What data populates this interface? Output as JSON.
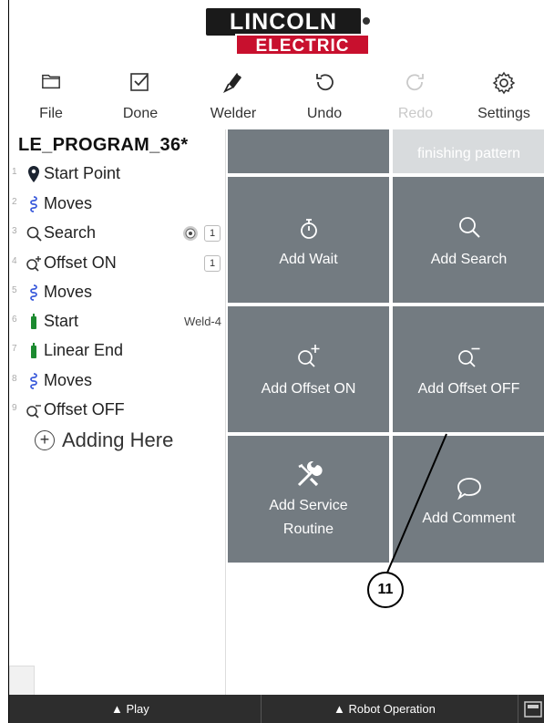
{
  "logo": {
    "line1": "LINCOLN",
    "line2": "ELECTRIC"
  },
  "toolbar": {
    "file": "File",
    "done": "Done",
    "welder": "Welder",
    "undo": "Undo",
    "redo": "Redo",
    "settings": "Settings"
  },
  "program": {
    "title": "LE_PROGRAM_36*",
    "items": [
      {
        "num": "1",
        "label": "Start Point",
        "icon": "location-pin-icon"
      },
      {
        "num": "2",
        "label": "Moves",
        "icon": "moves-squiggle-icon"
      },
      {
        "num": "3",
        "label": "Search",
        "icon": "search-icon",
        "badge": "1"
      },
      {
        "num": "4",
        "label": "Offset ON",
        "icon": "offset-on-icon",
        "badge": "1"
      },
      {
        "num": "5",
        "label": "Moves",
        "icon": "moves-squiggle-icon"
      },
      {
        "num": "6",
        "label": "Start",
        "icon": "weld-torch-icon",
        "side": "Weld-4"
      },
      {
        "num": "7",
        "label": "Linear End",
        "icon": "weld-torch-icon"
      },
      {
        "num": "8",
        "label": "Moves",
        "icon": "moves-squiggle-icon"
      },
      {
        "num": "9",
        "label": "Offset OFF",
        "icon": "offset-off-icon"
      }
    ],
    "adding_here": "Adding Here"
  },
  "grid": {
    "top_right": "finishing pattern",
    "add_wait": "Add Wait",
    "add_search": "Add Search",
    "add_offset_on": "Add Offset ON",
    "add_offset_off": "Add Offset OFF",
    "add_service_1": "Add Service",
    "add_service_2": "Routine",
    "add_comment": "Add Comment"
  },
  "callout": "11",
  "bottombar": {
    "play": "▲ Play",
    "robot_operation": "▲ Robot Operation"
  },
  "colors": {
    "tile": "#737b81",
    "tile_disabled": "#d8dbdd",
    "brand_red": "#c8102e",
    "bottom_bar": "#2d2d2d",
    "accent_blue": "#3b5bdb",
    "accent_green": "#1b8a2f"
  }
}
